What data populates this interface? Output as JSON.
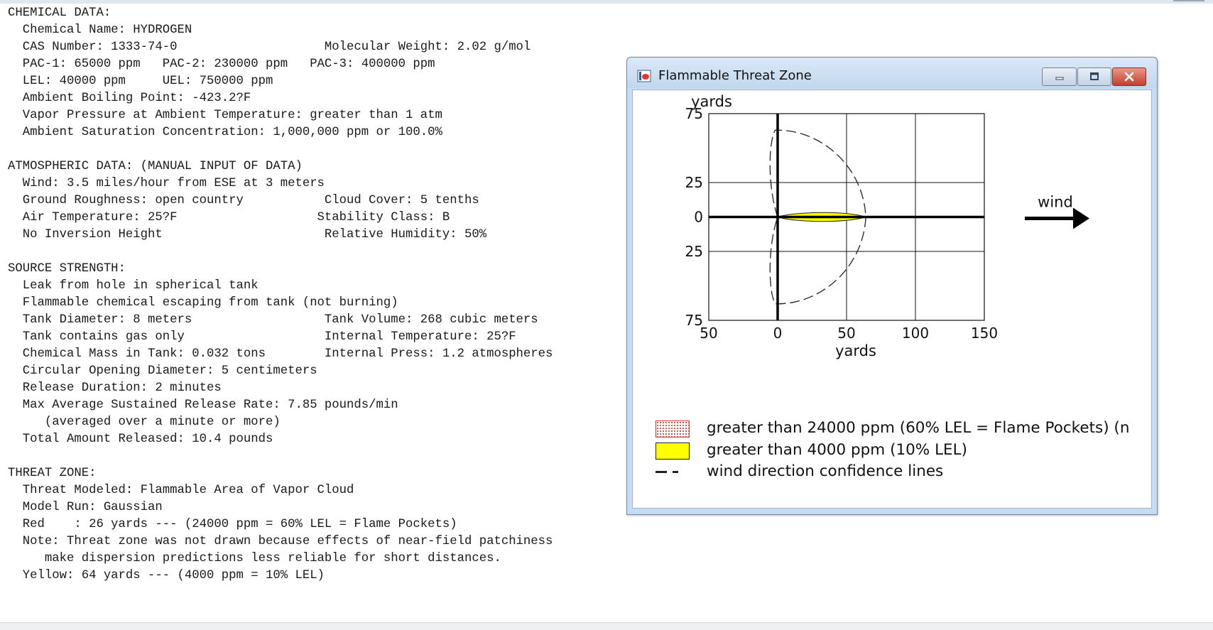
{
  "report_lines": [
    "CHEMICAL DATA:",
    "  Chemical Name: HYDROGEN",
    "  CAS Number: 1333-74-0                    Molecular Weight: 2.02 g/mol",
    "  PAC-1: 65000 ppm   PAC-2: 230000 ppm   PAC-3: 400000 ppm",
    "  LEL: 40000 ppm     UEL: 750000 ppm",
    "  Ambient Boiling Point: -423.2?F",
    "  Vapor Pressure at Ambient Temperature: greater than 1 atm",
    "  Ambient Saturation Concentration: 1,000,000 ppm or 100.0%",
    "",
    "ATMOSPHERIC DATA: (MANUAL INPUT OF DATA)",
    "  Wind: 3.5 miles/hour from ESE at 3 meters",
    "  Ground Roughness: open country           Cloud Cover: 5 tenths",
    "  Air Temperature: 25?F                   Stability Class: B",
    "  No Inversion Height                      Relative Humidity: 50%",
    "",
    "SOURCE STRENGTH:",
    "  Leak from hole in spherical tank",
    "  Flammable chemical escaping from tank (not burning)",
    "  Tank Diameter: 8 meters                  Tank Volume: 268 cubic meters",
    "  Tank contains gas only                   Internal Temperature: 25?F",
    "  Chemical Mass in Tank: 0.032 tons        Internal Press: 1.2 atmospheres",
    "  Circular Opening Diameter: 5 centimeters",
    "  Release Duration: 2 minutes",
    "  Max Average Sustained Release Rate: 7.85 pounds/min",
    "     (averaged over a minute or more)",
    "  Total Amount Released: 10.4 pounds",
    "",
    "THREAT ZONE:",
    "  Threat Modeled: Flammable Area of Vapor Cloud",
    "  Model Run: Gaussian",
    "  Red    : 26 yards --- (24000 ppm = 60% LEL = Flame Pockets)",
    "  Note: Threat zone was not drawn because effects of near-field patchiness",
    "     make dispersion predictions less reliable for short distances.",
    "  Yellow: 64 yards --- (4000 ppm = 10% LEL)"
  ],
  "window": {
    "title": "Flammable Threat Zone",
    "icons": {
      "app": "threat-zone-app-icon",
      "minimize": "minimize-icon",
      "maximize": "maximize-icon",
      "close": "close-icon"
    }
  },
  "chart_data": {
    "type": "area",
    "xlabel": "yards",
    "ylabel": "yards",
    "xlim": [
      -50,
      150
    ],
    "ylim": [
      -75,
      75
    ],
    "x_ticks": [
      -50,
      0,
      50,
      100,
      150
    ],
    "x_tick_labels": [
      "50",
      "0",
      "50",
      "100",
      "150"
    ],
    "y_ticks": [
      75,
      25,
      0,
      -25,
      -75
    ],
    "y_tick_labels": [
      "75",
      "25",
      "0",
      "25",
      "75"
    ],
    "grid": true,
    "wind_label": "wind",
    "series": [
      {
        "name": "greater than 4000 ppm (10% LEL)",
        "color": "#ffff00",
        "x_start": 0,
        "x_end": 64,
        "half_width": 4
      },
      {
        "name": "wind direction confidence lines",
        "color": "#222222",
        "line_style": "dashed",
        "x_start": -6,
        "x_end": 64,
        "max_half_width": 64
      }
    ],
    "legend": [
      {
        "label": "greater than 24000 ppm (60% LEL = Flame Pockets) (n",
        "swatch": "red-dotted"
      },
      {
        "label": "greater than 4000 ppm (10% LEL)",
        "swatch": "yellow"
      },
      {
        "label": "wind direction confidence lines",
        "swatch": "dashed"
      }
    ],
    "colors": {
      "red": "#e0392b",
      "yellow": "#ffff00"
    }
  }
}
